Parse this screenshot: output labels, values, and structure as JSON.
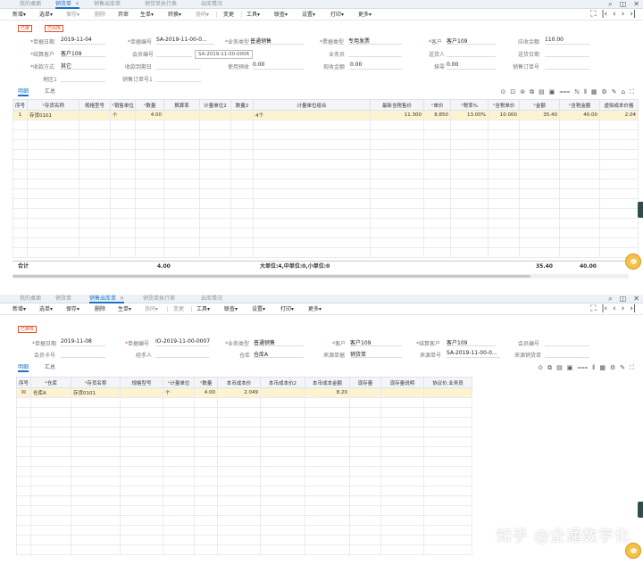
{
  "p1": {
    "tabs": [
      "我的桌面",
      "销货单",
      "销售出库单",
      "销货单执行表",
      "出库情况"
    ],
    "toolbar": [
      "新增",
      "选单",
      "保存",
      "删除",
      "弃审",
      "生单",
      "转换",
      "协同",
      "变更",
      "工具",
      "联查",
      "设置",
      "打印",
      "更多"
    ],
    "status": [
      "已审",
      "已出库"
    ],
    "fields": {
      "date_label": "单据日期",
      "date_value": "2019-11-04",
      "code_label": "单据编号",
      "code_value": "SA-2019-11-00-0...",
      "biztype_label": "业务类型",
      "biztype_value": "普通销售",
      "invtype_label": "票据类型",
      "invtype_value": "专用发票",
      "customer_label": "客户",
      "customer_value": "客户109",
      "receivable_label": "应收余额",
      "receivable_value": "110.00",
      "settle_label": "结算客户",
      "settle_value": "客户109",
      "member_label": "会员编号",
      "member_value": "",
      "salesman_label": "业务员",
      "salesman_value": "",
      "shipto_label": "送货人",
      "shipto_value": "",
      "receipt_label": "收款方式",
      "receipt_value": "其它",
      "duedate_label": "收款到期日",
      "duedate_value": "",
      "prepay_label": "使用预收",
      "prepay_value": "0.00",
      "cash_label": "现收金额",
      "cash_value": "0.00",
      "discount_label": "抹零",
      "discount_value": "0.00",
      "order_label": "销售订单号",
      "order_value": "",
      "region_label": "地区1",
      "region_value": "",
      "saleorder_label": "销售订单号1",
      "saleorder_value": "",
      "deliverydate_label": "送货日期",
      "deliverydate_value": "",
      "tooltip": "SA-2019-11-00-0006"
    },
    "subtabs": [
      "明细",
      "汇总"
    ],
    "columns": [
      "序号",
      "存货名称",
      "规格型号",
      "销售单位",
      "数量",
      "换算率",
      "计量单位2",
      "数量2",
      "计量单位组合",
      "最新含税售价",
      "单价",
      "税率%",
      "含税单价",
      "金额",
      "含税金额",
      "虚拟成本价格"
    ],
    "required": [
      false,
      true,
      false,
      true,
      true,
      false,
      false,
      false,
      false,
      false,
      true,
      true,
      true,
      true,
      true,
      false
    ],
    "row": [
      "1",
      "存货0101",
      "",
      "个",
      "4.00",
      "",
      "",
      "",
      "4个",
      "11.300",
      "8.850",
      "13.00%",
      "10.000",
      "35.40",
      "40.00",
      "2.04"
    ],
    "total": {
      "label": "合计",
      "qty": "4.00",
      "unitsum": "大单位:4,中单位:0,小单位:0",
      "amount": "35.40",
      "taxamount": "40.00"
    }
  },
  "p2": {
    "tabs": [
      "我的桌面",
      "销货单",
      "销售出库单",
      "销货单执行表",
      "出库情况"
    ],
    "toolbar": [
      "新增",
      "选单",
      "保存",
      "删除",
      "生单",
      "协同",
      "变更",
      "工具",
      "联查",
      "设置",
      "打印",
      "更多"
    ],
    "status": [
      "已审核"
    ],
    "fields": {
      "date_label": "单据日期",
      "date_value": "2019-11-08",
      "code_label": "单据编号",
      "code_value": "IO-2019-11-00-0007",
      "biztype_label": "业务类型",
      "biztype_value": "普通销售",
      "customer_label": "客户",
      "customer_value": "客户109",
      "settle_label": "结算客户",
      "settle_value": "客户109",
      "member_label": "会员编号",
      "member_value": "",
      "cardno_label": "会员卡号",
      "cardno_value": "",
      "handler_label": "经手人",
      "handler_value": "",
      "warehouse_label": "仓库",
      "warehouse_value": "仓库A",
      "src_label": "来源单据",
      "src_value": "销货单",
      "srcno_label": "来源单号",
      "srcno_value": "SA-2019-11-00-0...",
      "srcorder_label": "来源销货单",
      "srcorder_value": ""
    },
    "subtabs": [
      "明细",
      "汇总"
    ],
    "columns": [
      "序号",
      "仓库",
      "存货名称",
      "规格型号",
      "计量单位",
      "数量",
      "本币成本价",
      "本币成本价2",
      "本币成本金额",
      "现存量",
      "现存量说明",
      "协议价.业务员"
    ],
    "required": [
      false,
      true,
      true,
      false,
      true,
      true,
      false,
      false,
      false,
      false,
      false,
      false
    ],
    "row": [
      "☒",
      "仓库A",
      "存货0101",
      "",
      "个",
      "4.00",
      "2.049",
      "",
      "8.20",
      "",
      "",
      ""
    ]
  },
  "watermark": "知乎 @企通数字化"
}
